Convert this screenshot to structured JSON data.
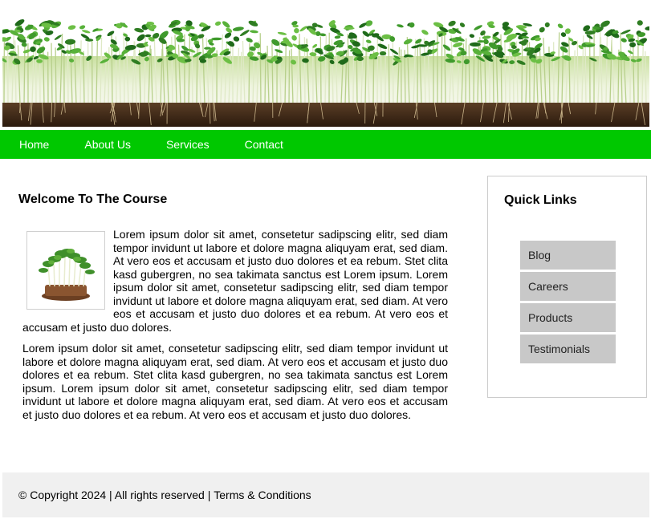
{
  "banner": {
    "image": "microgreens-sprouts-banner"
  },
  "nav": {
    "items": [
      "Home",
      "About Us",
      "Services",
      "Contact"
    ],
    "color": "#00c800"
  },
  "main": {
    "title": "Welcome To The Course",
    "thumbnail": "microgreens-sprouts-thumbnail",
    "paragraph1": "Lorem ipsum dolor sit amet, consetetur sadipscing elitr, sed diam tempor invidunt ut labore et dolore magna aliquyam erat, sed diam. At vero eos et accusam et justo duo dolores et ea rebum. Stet clita kasd gubergren, no sea takimata sanctus est Lorem ipsum. Lorem ipsum dolor sit amet, consetetur sadipscing elitr, sed diam tempor invidunt ut labore et dolore magna aliquyam erat, sed diam. At vero eos et accusam et justo duo dolores et ea rebum. At vero eos et accusam et justo duo dolores.",
    "paragraph2": "Lorem ipsum dolor sit amet, consetetur sadipscing elitr, sed diam tempor invidunt ut labore et dolore magna aliquyam erat, sed diam. At vero eos et accusam et justo duo dolores et ea rebum. Stet clita kasd gubergren, no sea takimata sanctus est Lorem ipsum. Lorem ipsum dolor sit amet, consetetur sadipscing elitr, sed diam tempor invidunt ut labore et dolore magna aliquyam erat, sed diam. At vero eos et accusam et justo duo dolores et ea rebum. At vero eos et accusam et justo duo dolores."
  },
  "sidebar": {
    "title": "Quick Links",
    "links": [
      "Blog",
      "Careers",
      "Products",
      "Testimonials"
    ]
  },
  "footer": {
    "text": "© Copyright 2024 | All rights reserved | ",
    "link": "Terms & Conditions"
  }
}
